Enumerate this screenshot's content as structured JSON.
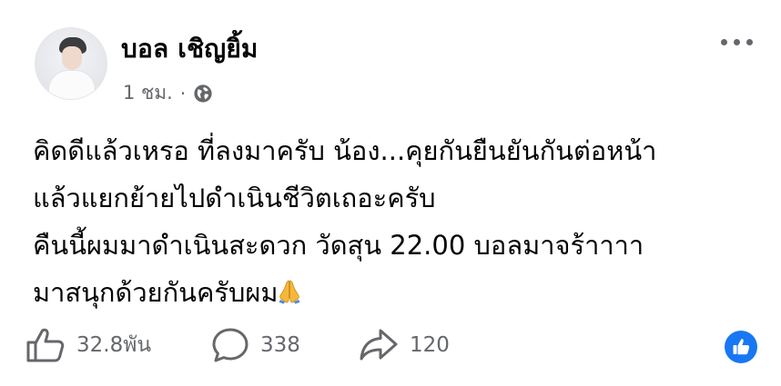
{
  "post": {
    "author_name": "บอล เชิญยิ้ม",
    "timestamp": "1 ชม.",
    "separator": "·",
    "privacy_icon": "globe-icon",
    "body_lines": [
      "คิดดีแล้วเหรอ ที่ลงมาครับ น้อง...คุยกันยืนยันกันต่อหน้า",
      "แล้วแยกย้ายไปดำเนินชีวิตเถอะครับ",
      "คืนนี้ผมมาดำเนินสะดวก วัดสุน 22.00 บอลมาจร้าาาา",
      "มาสนุกด้วยกันครับผม"
    ],
    "emoji": "folded-hands-emoji"
  },
  "stats": {
    "likes": "32.8พัน",
    "comments": "338",
    "shares": "120"
  },
  "colors": {
    "accent": "#1877f2",
    "secondary_text": "#65676b",
    "primary_text": "#050505"
  }
}
